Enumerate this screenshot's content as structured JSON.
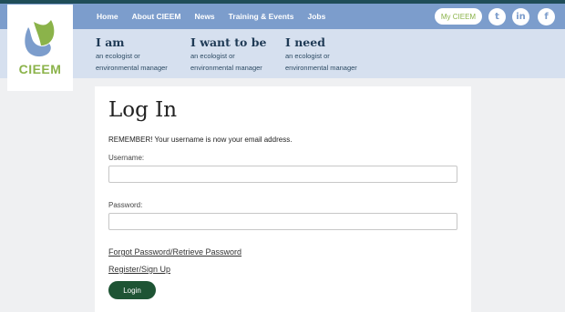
{
  "nav": {
    "items": [
      "Home",
      "About CIEEM",
      "News",
      "Training & Events",
      "Jobs"
    ],
    "my_cieem": "My CIEEM",
    "social": [
      {
        "name": "twitter-icon",
        "glyph": "t"
      },
      {
        "name": "linkedin-icon",
        "glyph": "in"
      },
      {
        "name": "facebook-icon",
        "glyph": "f"
      }
    ]
  },
  "logo": {
    "text": "CIEEM"
  },
  "subnav": [
    {
      "title": "I am",
      "line1": "an ecologist or",
      "line2": "environmental manager"
    },
    {
      "title": "I want to be",
      "line1": "an ecologist or",
      "line2": "environmental manager"
    },
    {
      "title": "I need",
      "line1": "an ecologist or",
      "line2": "environmental manager"
    }
  ],
  "login": {
    "title": "Log In",
    "remember": "REMEMBER! Your username is now your email address.",
    "username_label": "Username:",
    "username_value": "",
    "password_label": "Password:",
    "password_value": "",
    "forgot_link": "Forgot Password/Retrieve Password",
    "register_link": "Register/Sign Up",
    "button": "Login"
  },
  "colors": {
    "nav": "#7c9dcc",
    "subnav": "#d6e0ef",
    "brand_green": "#8bb34a",
    "button": "#1e5434"
  }
}
